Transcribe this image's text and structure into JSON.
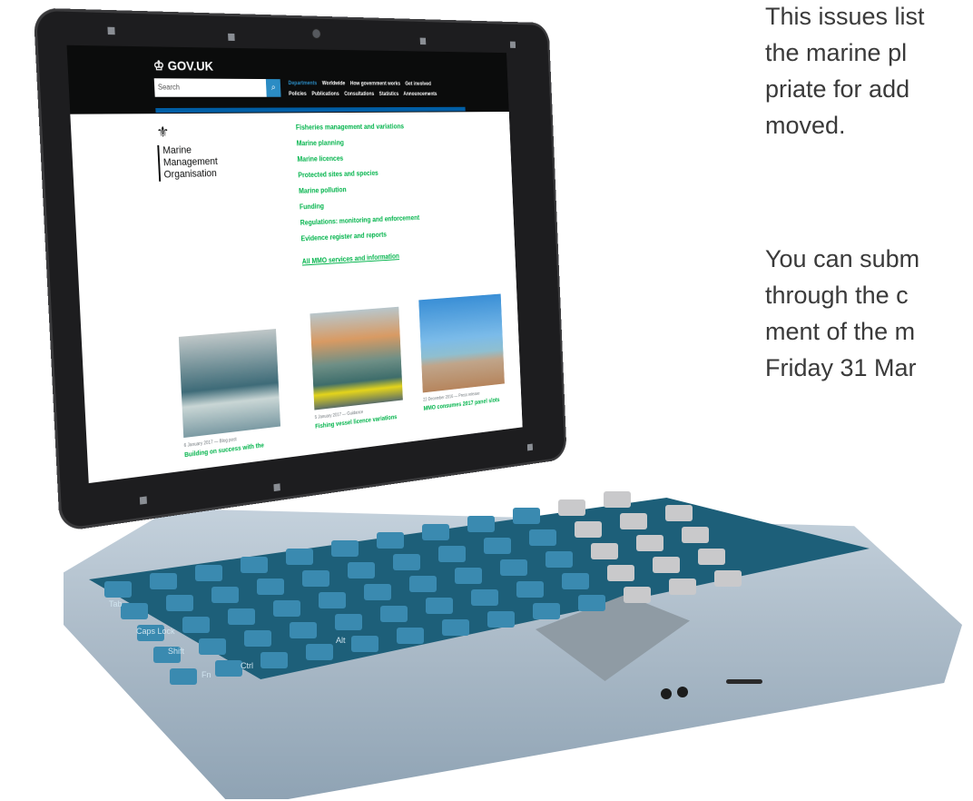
{
  "side_text": {
    "para1_lines": [
      "This issues list",
      "the marine pl",
      "priate for add",
      "moved."
    ],
    "para2_lines": [
      "You can subm",
      "through the c",
      "ment of the m",
      "Friday 31 Mar"
    ]
  },
  "screen": {
    "logo": "GOV.UK",
    "search_placeholder": "Search",
    "nav_row1": [
      "Departments",
      "Worldwide",
      "How government works",
      "Get involved"
    ],
    "nav_row2": [
      "Policies",
      "Publications",
      "Consultations",
      "Statistics",
      "Announcements"
    ],
    "org_name": [
      "Marine",
      "Management",
      "Organisation"
    ],
    "links": [
      "Fisheries management and variations",
      "Marine planning",
      "Marine licences",
      "Protected sites and species",
      "Marine pollution",
      "Funding",
      "Regulations: monitoring and enforcement",
      "Evidence register and reports"
    ],
    "all_link": "All MMO services and information",
    "news": [
      {
        "meta": "6 January 2017 — Blog post",
        "title": "Building on success with the"
      },
      {
        "meta": "5 January 2017 — Guidance",
        "title": "Fishing vessel licence variations"
      },
      {
        "meta": "22 December 2016 — Press release",
        "title": "MMO consumes 2017 panel slots"
      }
    ]
  },
  "keyboard_labels": [
    "Tab",
    "Caps Lock",
    "Shift",
    "Fn",
    "Ctrl",
    "Alt"
  ]
}
